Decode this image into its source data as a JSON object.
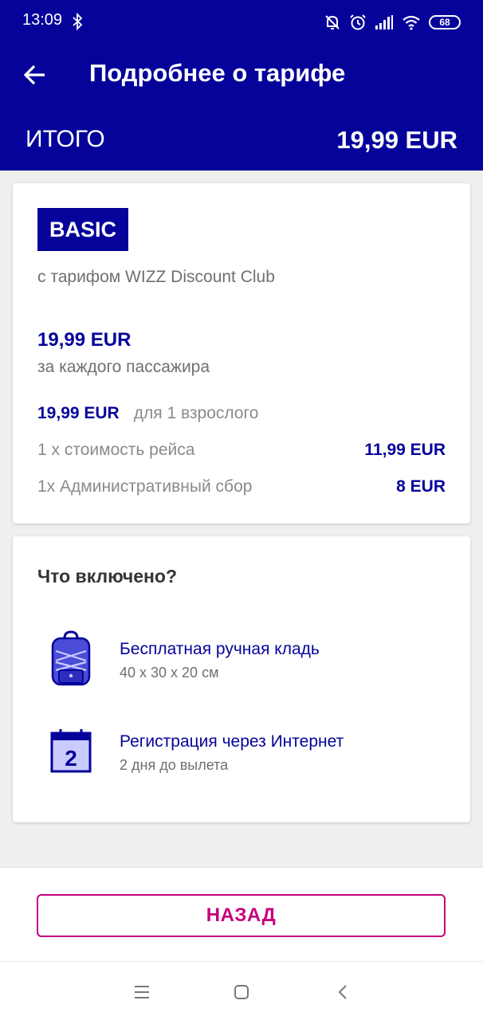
{
  "status_bar": {
    "time": "13:09",
    "battery": "68",
    "icons": [
      "bluetooth-icon",
      "mute-icon",
      "alarm-icon",
      "signal-icon",
      "wifi-icon",
      "battery-icon"
    ]
  },
  "header": {
    "title": "Подробнее о тарифе",
    "total_label": "ИТОГО",
    "total_value": "19,99 EUR",
    "background_color": "#06039a"
  },
  "fare": {
    "name": "BASIC",
    "subtitle": "с тарифом WIZZ Discount Club",
    "per_passenger_price": "19,99 EUR",
    "per_passenger_label": "за каждого пассажира",
    "adult_price": "19,99 EUR",
    "adult_label": "для 1 взрослого",
    "lines": [
      {
        "label": "1 x стоимость рейса",
        "value": "11,99 EUR"
      },
      {
        "label": "1x Административный сбор",
        "value": "8 EUR"
      }
    ]
  },
  "included": {
    "title": "Что включено?",
    "items": [
      {
        "icon": "backpack-icon",
        "title": "Бесплатная ручная кладь",
        "subtitle": "40 x 30 x 20 см"
      },
      {
        "icon": "calendar-icon",
        "title": "Регистрация через Интернет",
        "subtitle": "2 дня до вылета",
        "icon_text": "2"
      }
    ]
  },
  "actions": {
    "back_label": "НАЗАД",
    "accent_color": "#c6007e"
  },
  "nav_bar": {
    "icons": [
      "menu-icon",
      "home-icon",
      "back-nav-icon"
    ]
  }
}
